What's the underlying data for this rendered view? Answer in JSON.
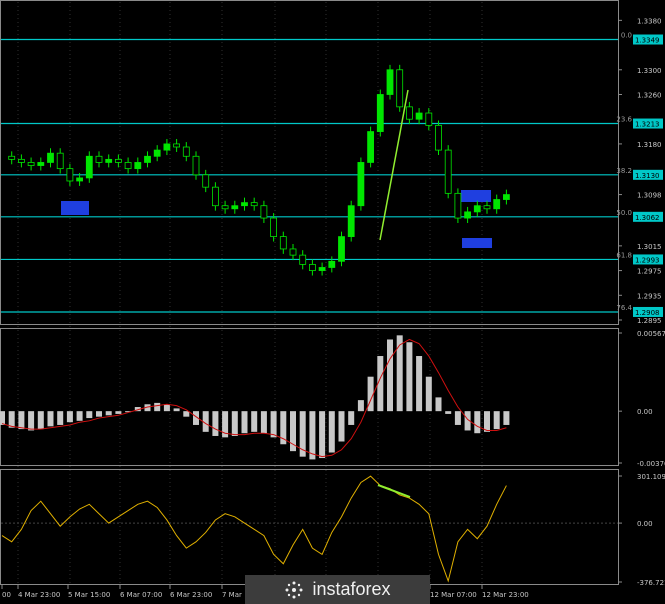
{
  "price_axis": {
    "labels": [
      "1.3380",
      "1.3300",
      "1.3260",
      "1.3180",
      "1.3098",
      "1.3015",
      "1.2975",
      "1.2935",
      "1.2895"
    ],
    "values": [
      1.338,
      1.33,
      1.326,
      1.318,
      1.3098,
      1.3015,
      1.2975,
      1.2935,
      1.2895
    ],
    "current": "1.3098"
  },
  "fib_levels": [
    {
      "tag": "0.0",
      "price": "1.3349",
      "value": 1.3349
    },
    {
      "tag": "23.6",
      "price": "1.3213",
      "value": 1.3213
    },
    {
      "tag": "38.2",
      "price": "1.3130",
      "value": 1.313
    },
    {
      "tag": "50.0",
      "price": "1.3062",
      "value": 1.3062
    },
    {
      "tag": "61.8",
      "price": "1.2993",
      "value": 1.2993
    },
    {
      "tag": "76.4",
      "price": "1.2908",
      "value": 1.2908
    }
  ],
  "macd_axis": {
    "labels": [
      "0.00567",
      "0.00",
      "-0.00376"
    ],
    "values": [
      0.00567,
      0,
      -0.00376
    ]
  },
  "cci_axis": {
    "labels": [
      "301.1093",
      "0.00",
      "-376.7214"
    ],
    "values": [
      301.1093,
      0,
      -376.7214
    ]
  },
  "time_axis": {
    "labels": [
      "00",
      "4 Mar 23:00",
      "5 Mar 15:00",
      "6 Mar 07:00",
      "6 Mar 23:00",
      "7 Mar",
      "12 Mar 07:00",
      "12 Mar 23:00"
    ]
  },
  "watermark": {
    "text": "instaforex",
    "icon": "instaforex-logo-icon"
  },
  "colors": {
    "background": "#000000",
    "candles": "#00e600",
    "fib_lines": "#00c8c8",
    "trend_line": "#90ee30",
    "zones": "#1f3fe0",
    "macd_hist": "#c8c8c8",
    "macd_signal": "#d01010",
    "cci": "#e0b000",
    "divergence": "#90ee30"
  },
  "chart_data": [
    {
      "type": "candlestick",
      "name": "price",
      "ylim": [
        1.2895,
        1.34
      ],
      "levels": [
        1.3349,
        1.3213,
        1.313,
        1.3062,
        1.2993,
        1.2908
      ],
      "close_path": [
        1.316,
        1.3155,
        1.315,
        1.3145,
        1.315,
        1.3165,
        1.314,
        1.312,
        1.3125,
        1.316,
        1.315,
        1.3155,
        1.315,
        1.314,
        1.315,
        1.316,
        1.317,
        1.318,
        1.3175,
        1.316,
        1.313,
        1.311,
        1.308,
        1.3075,
        1.308,
        1.3085,
        1.308,
        1.306,
        1.303,
        1.301,
        1.3,
        1.2985,
        1.2975,
        1.298,
        1.299,
        1.303,
        1.308,
        1.315,
        1.32,
        1.326,
        1.33,
        1.324,
        1.322,
        1.323,
        1.321,
        1.317,
        1.31,
        1.306,
        1.307,
        1.308,
        1.3075,
        1.309,
        1.3098
      ]
    },
    {
      "type": "bar",
      "name": "macd",
      "ylim": [
        -0.00376,
        0.00567
      ],
      "values": [
        -0.001,
        -0.0012,
        -0.0013,
        -0.0014,
        -0.0013,
        -0.0011,
        -0.001,
        -0.0008,
        -0.0007,
        -0.0005,
        -0.0004,
        -0.0003,
        -0.0002,
        0.0,
        0.0003,
        0.0005,
        0.0006,
        0.0005,
        0.0002,
        -0.0004,
        -0.001,
        -0.0015,
        -0.0018,
        -0.0019,
        -0.0018,
        -0.0016,
        -0.0015,
        -0.0016,
        -0.0019,
        -0.0024,
        -0.0029,
        -0.0033,
        -0.0035,
        -0.0034,
        -0.003,
        -0.0022,
        -0.001,
        0.0008,
        0.0025,
        0.004,
        0.0052,
        0.0055,
        0.005,
        0.004,
        0.0025,
        0.001,
        -0.0002,
        -0.001,
        -0.0014,
        -0.0016,
        -0.0015,
        -0.0013,
        -0.001
      ],
      "signal": [
        -0.0009,
        -0.0011,
        -0.0012,
        -0.0013,
        -0.0013,
        -0.0012,
        -0.0011,
        -0.001,
        -0.0008,
        -0.0007,
        -0.0005,
        -0.0004,
        -0.0003,
        -0.0001,
        0.0001,
        0.0003,
        0.0004,
        0.0005,
        0.0004,
        0.0001,
        -0.0004,
        -0.0009,
        -0.0013,
        -0.0016,
        -0.0017,
        -0.0017,
        -0.0016,
        -0.0016,
        -0.0017,
        -0.002,
        -0.0024,
        -0.0028,
        -0.0031,
        -0.0033,
        -0.0032,
        -0.0028,
        -0.002,
        -0.0008,
        0.0008,
        0.0024,
        0.0038,
        0.0048,
        0.0052,
        0.0049,
        0.004,
        0.0028,
        0.0015,
        0.0003,
        -0.0006,
        -0.0011,
        -0.0014,
        -0.0014,
        -0.0012
      ]
    },
    {
      "type": "line",
      "name": "cci",
      "ylim": [
        -376.7214,
        301.1093
      ],
      "values": [
        -80,
        -120,
        -40,
        80,
        140,
        60,
        -20,
        40,
        90,
        120,
        60,
        0,
        40,
        80,
        120,
        140,
        100,
        20,
        -80,
        -160,
        -120,
        -60,
        20,
        60,
        40,
        0,
        -40,
        -80,
        -200,
        -260,
        -140,
        -40,
        -160,
        -200,
        -60,
        40,
        160,
        260,
        300,
        240,
        220,
        180,
        160,
        120,
        60,
        -200,
        -370,
        -120,
        -40,
        -100,
        -20,
        120,
        240
      ]
    }
  ]
}
